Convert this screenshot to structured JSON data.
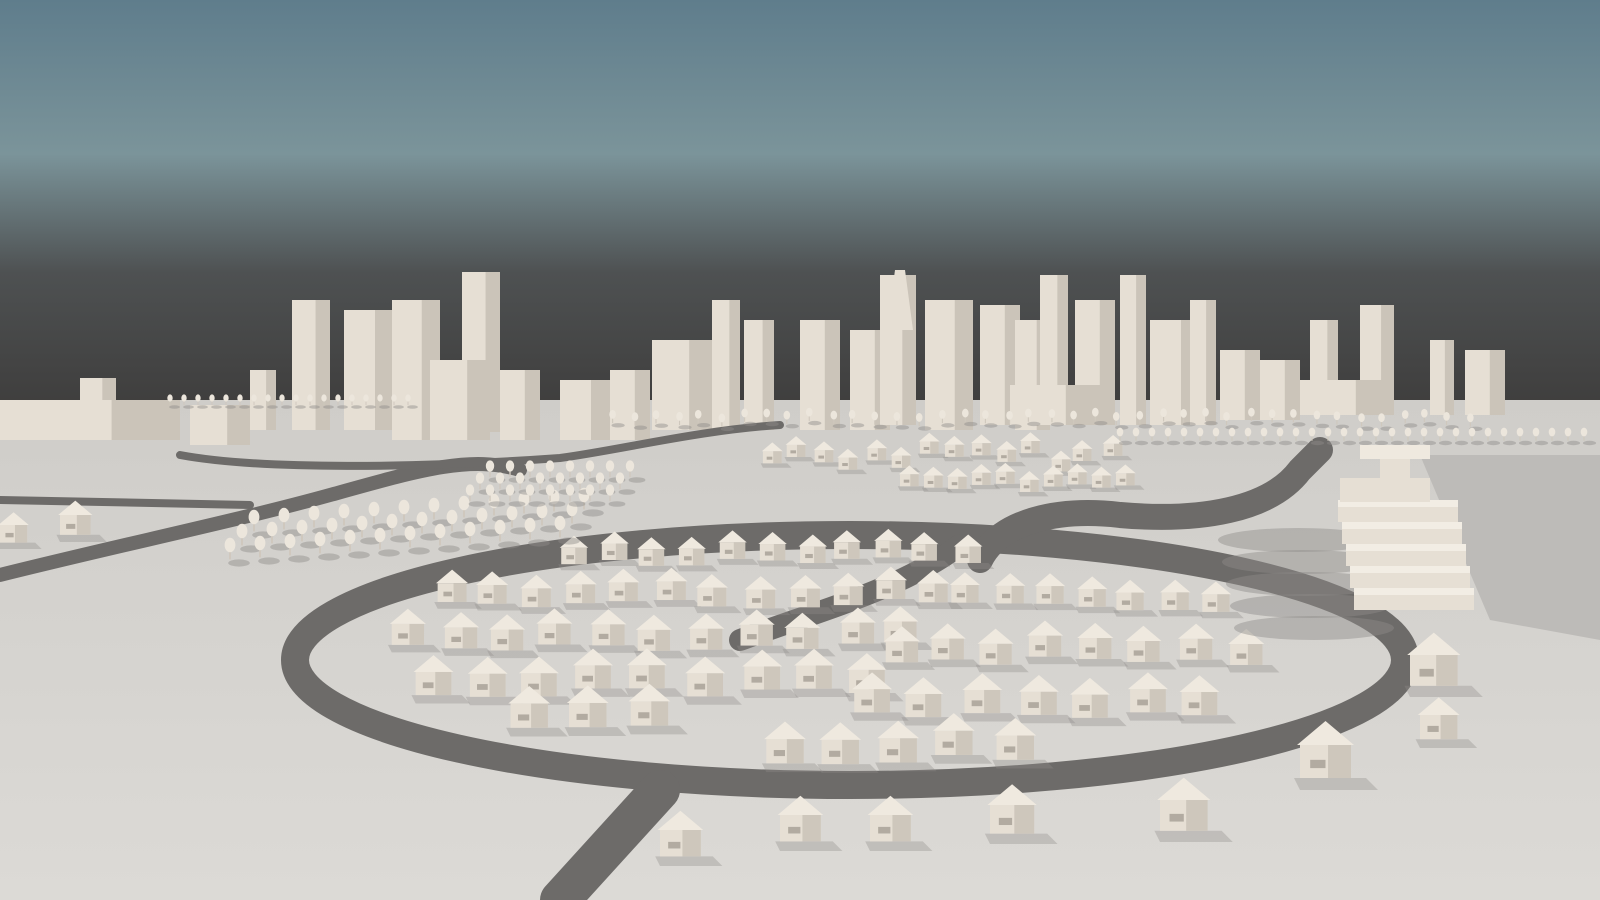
{
  "scene": {
    "kind": "3D clay render of a city model",
    "colors": {
      "sky_top": "#5f7d8c",
      "sky_mid": "#7b949a",
      "haze": "#3b3938",
      "ground": "#d8d6d3",
      "road": "#6d6b69",
      "building": "#e6dfd4",
      "building_shade": "#b9b2a7",
      "shadow": "#8e8c89"
    }
  }
}
